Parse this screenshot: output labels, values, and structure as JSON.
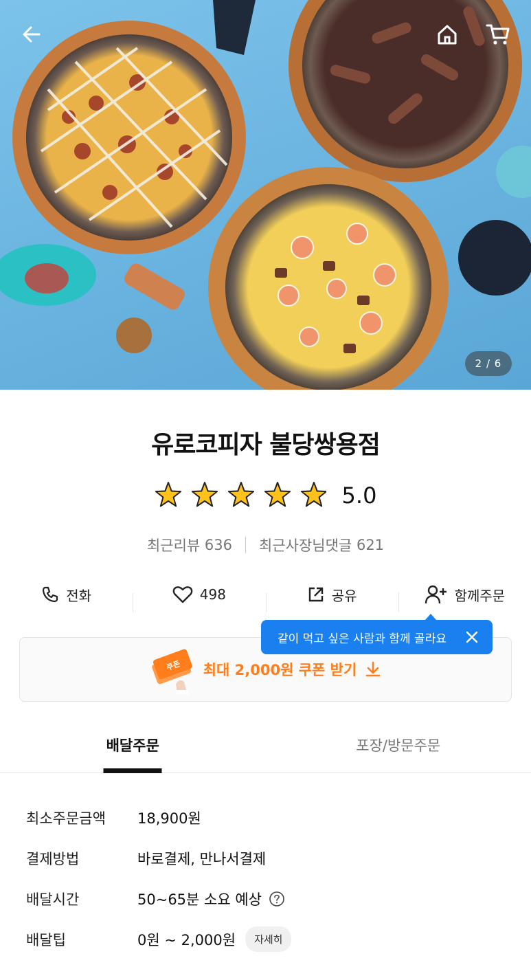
{
  "hero": {
    "pager": "2 / 6",
    "back_icon": "back-arrow-icon",
    "home_icon": "home-icon",
    "cart_icon": "cart-icon"
  },
  "store": {
    "name": "유로코피자 불당쌍용점",
    "rating": "5.0",
    "stars": 5,
    "recent_reviews_label": "최근리뷰",
    "recent_reviews_count": "636",
    "owner_replies_label": "최근사장님댓글",
    "owner_replies_count": "621"
  },
  "actions": {
    "call": "전화",
    "like_count": "498",
    "share": "공유",
    "group_order": "함께주문"
  },
  "tooltip": {
    "text": "같이 먹고 싶은 사람과 함께 골라요"
  },
  "coupon": {
    "badge": "쿠폰",
    "text": "최대 2,000원 쿠폰 받기"
  },
  "tabs": [
    {
      "label": "배달주문",
      "active": true
    },
    {
      "label": "포장/방문주문",
      "active": false
    }
  ],
  "info": {
    "min_order": {
      "label": "최소주문금액",
      "value": "18,900원"
    },
    "payment": {
      "label": "결제방법",
      "value": "바로결제, 만나서결제"
    },
    "delivery_time": {
      "label": "배달시간",
      "value": "50~65분 소요 예상"
    },
    "delivery_tip": {
      "label": "배달팁",
      "value": "0원 ~ 2,000원",
      "detail_button": "자세히"
    }
  },
  "colors": {
    "accent_orange": "#ff7d1a",
    "tooltip_blue": "#1a80f0",
    "star": "#ffc21a"
  }
}
